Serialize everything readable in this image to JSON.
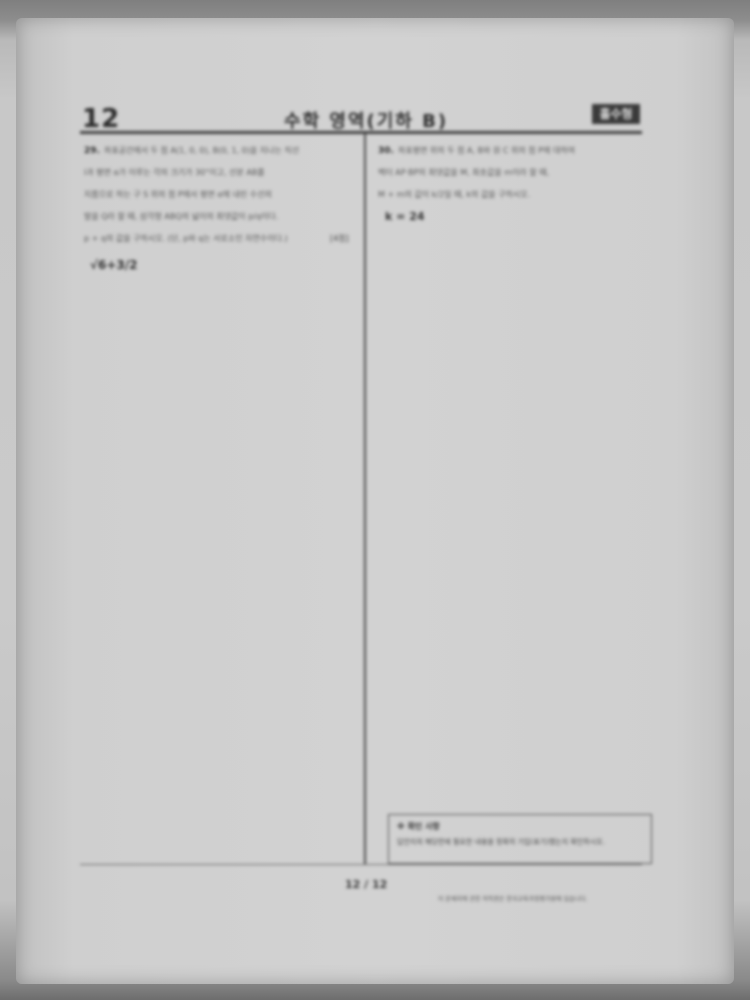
{
  "header": {
    "page_number": "12",
    "title": "수학 영역(기하 B)",
    "badge": "홀수형"
  },
  "left_question": {
    "number": "29.",
    "text_lines": [
      "좌표공간에서 두 점 A(1, 0, 0), B(0, 1, 0)을 지나는 직선",
      "l과 평면 α가 이루는 각의 크기가 30°이고, 선분 AB를",
      "지름으로 하는 구 S 위의 점 P에서 평면 α에 내린 수선의",
      "발을 Q라 할 때, 삼각형 ABQ의 넓이의 최댓값이 p/q이다.",
      "p + q의 값을 구하시오. (단, p와 q는 서로소인 자연수이다.)"
    ],
    "score": "[4점]",
    "answer_work": "√6+3/2"
  },
  "right_question": {
    "number": "30.",
    "text_lines": [
      "좌표평면 위의 두 점 A, B와 원 C 위의 점 P에 대하여",
      "벡터 AP·BP의 최댓값을 M, 최솟값을 m이라 할 때,",
      "M + m의 값이 k/2일 때, k의 값을 구하시오."
    ],
    "answer_work": "k = 24"
  },
  "note_box": {
    "line1": "※ 확인 사항",
    "line2": "답안지의 해당란에 필요한 내용을 정확히 기입(표기)했는지 확인하시오."
  },
  "footer": {
    "page_label": "12 / 12",
    "source": "이 문제지에 관한 저작권은 한국교육과정평가원에 있습니다."
  }
}
